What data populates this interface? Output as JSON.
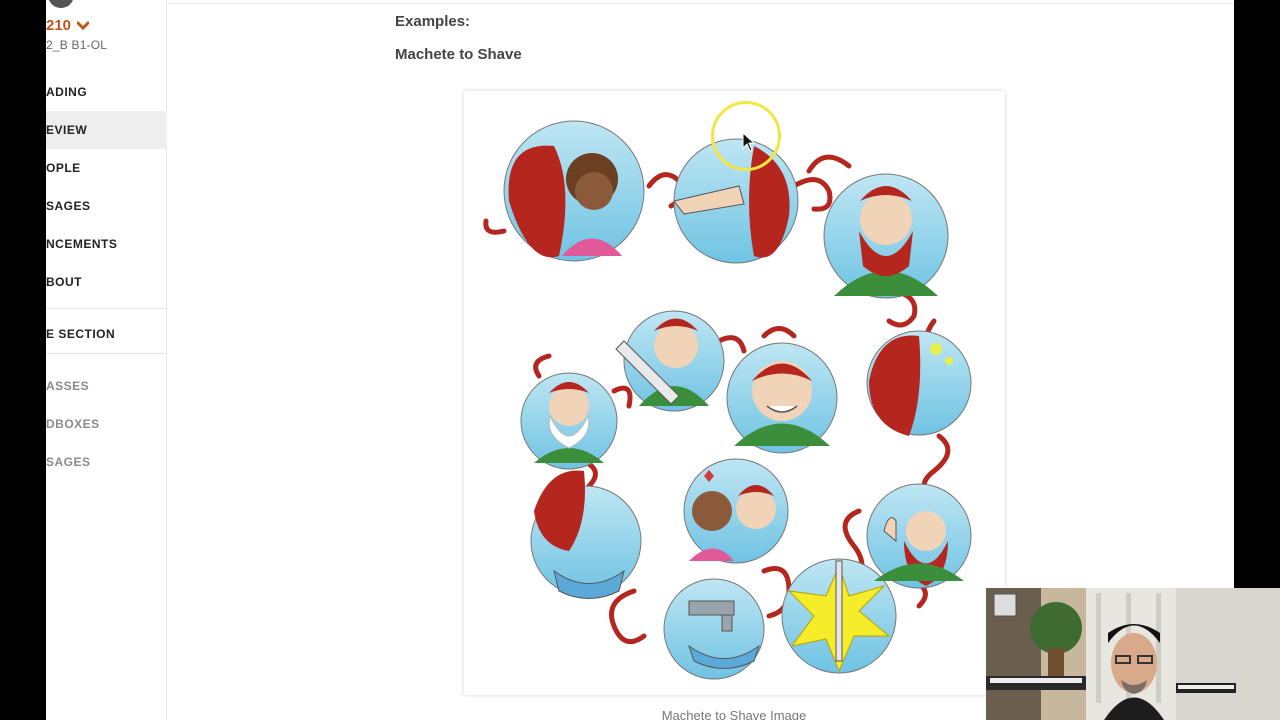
{
  "sidebar": {
    "course_code": "210",
    "course_sub": "2_B B1-OL",
    "items": [
      {
        "label": "ADING"
      },
      {
        "label": "EVIEW"
      },
      {
        "label": "OPLE"
      },
      {
        "label": "SAGES"
      },
      {
        "label": "NCEMENTS"
      },
      {
        "label": "BOUT"
      }
    ],
    "section_label": "E SECTION",
    "sub_items": [
      {
        "label": "ASSES"
      },
      {
        "label": "DBOXES"
      },
      {
        "label": "SAGES"
      }
    ]
  },
  "main": {
    "examples_label": "Examples:",
    "section_title": "Machete to Shave",
    "caption": "Machete to Shave Image"
  },
  "colors": {
    "accent": "#c0561b",
    "cursor_highlight": "#f2e640",
    "beard_red": "#b5261e",
    "bubble_blue": "#8fd0e8",
    "shirt_green": "#3b8f3c",
    "shirt_pink": "#e05a9a",
    "sword_yellow": "#f5ec2a"
  },
  "icons": {
    "dropdown": "chevron-down-icon",
    "pointer": "mouse-pointer-icon"
  }
}
